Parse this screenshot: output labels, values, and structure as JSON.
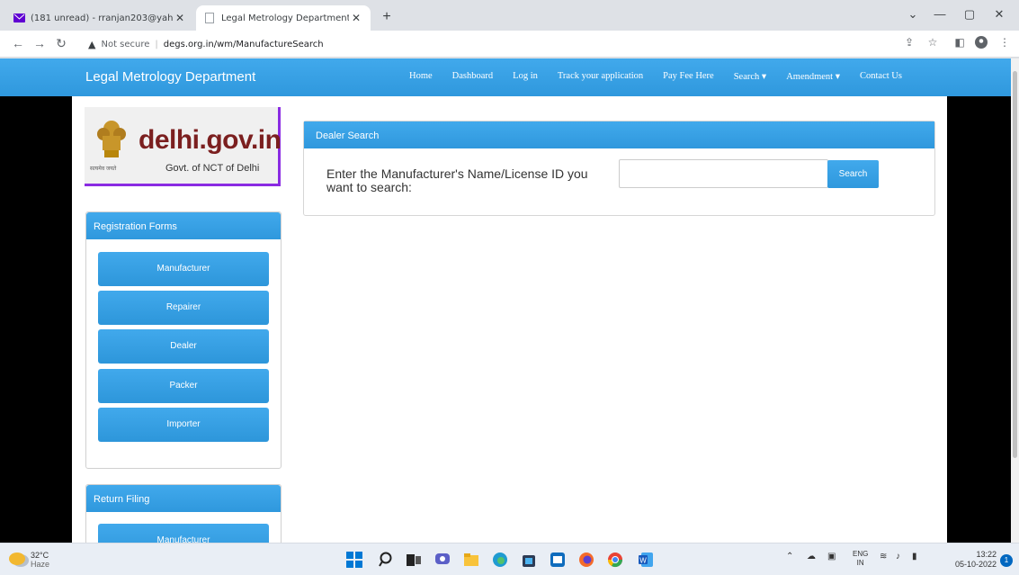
{
  "browser": {
    "tabs": [
      {
        "title": "(181 unread) - rranjan203@yahc",
        "active": false
      },
      {
        "title": "Legal Metrology Department",
        "active": true
      }
    ],
    "new_tab": "+",
    "window_controls": {
      "dropdown": "⌄",
      "minimize": "—",
      "maximize": "▢",
      "close": "✕"
    },
    "nav": {
      "back": "←",
      "forward": "→",
      "reload": "↻"
    },
    "security_label": "Not secure",
    "url": "degs.org.in/wm/ManufactureSearch",
    "url_icons": [
      "share-icon",
      "star-icon",
      "extensions-icon",
      "profile-icon",
      "menu-icon"
    ]
  },
  "site": {
    "brand": "Legal Metrology Department",
    "nav": [
      "Home",
      "Dashboard",
      "Log in",
      "Track your application",
      "Pay Fee Here",
      "Search ▾",
      "Amendment ▾",
      "Contact Us"
    ]
  },
  "logo": {
    "site": "delhi.gov.in",
    "tagline": "Govt. of NCT of Delhi",
    "motto": "सत्यमेव जयते"
  },
  "sidebar": {
    "registration": {
      "title": "Registration Forms",
      "items": [
        "Manufacturer",
        "Repairer",
        "Dealer",
        "Packer",
        "Importer"
      ]
    },
    "return": {
      "title": "Return Filing",
      "items": [
        "Manufacturer"
      ]
    }
  },
  "search_card": {
    "title": "Dealer Search",
    "prompt": "Enter the Manufacturer's Name/License ID you want to search:",
    "input_value": "",
    "button": "Search"
  },
  "taskbar": {
    "weather_temp": "32°C",
    "weather_desc": "Haze",
    "lang": "ENG",
    "region": "IN",
    "time": "13:22",
    "date": "05-10-2022",
    "notifications": "1"
  },
  "colors": {
    "accent": "#35a0e3",
    "page_bg": "#000000"
  }
}
